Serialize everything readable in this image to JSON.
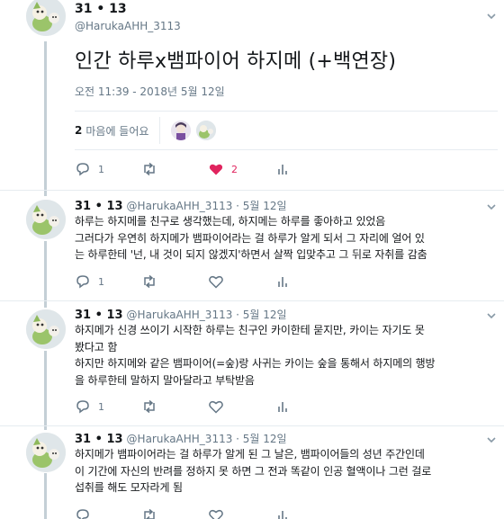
{
  "main_tweet": {
    "author_name": "31 • 13",
    "author_handle": "@HarukaAHH_3113",
    "text": "인간 하루x뱀파이어 하지메 (+백연장)",
    "timestamp": "오전 11:39 - 2018년 5월 12일",
    "likes_count": "2",
    "likes_label": "마음에 들어요",
    "actions": {
      "reply_count": "1",
      "retweet_count": "",
      "like_count": "2"
    }
  },
  "replies": [
    {
      "author_name": "31 • 13",
      "meta": "@HarukaAHH_3113 · 5월 12일",
      "lines": [
        "하루는 하지메를 친구로 생각했는데, 하지메는 하루를 좋아하고 있었음",
        "그러다가 우연히 하지메가 뱀파이어라는 걸 하루가 알게 되서 그 자리에 얼어 있",
        "는 하루한테 '넌, 내 것이 되지 않겠지'하면서 살짝 입맞추고 그 뒤로 자취를 감춤"
      ],
      "reply_count": "1"
    },
    {
      "author_name": "31 • 13",
      "meta": "@HarukaAHH_3113 · 5월 12일",
      "lines": [
        "하지메가 신경 쓰이기 시작한 하루는 친구인 카이한테 묻지만, 카이는 자기도 못",
        "봤다고 함",
        "하지만 하지메와 같은 뱀파이어(=숲)랑 사귀는 카이는 숲을 통해서 하지메의 행방",
        "을 하루한테 말하지 말아달라고 부탁받음"
      ],
      "reply_count": "1"
    },
    {
      "author_name": "31 • 13",
      "meta": "@HarukaAHH_3113 · 5월 12일",
      "lines": [
        "하지메가 뱀파이어라는 걸 하루가 알게 된 그 날은, 뱀파이어들의 성년 주간인데",
        "이 기간에 자신의 반려를 정하지 못 하면 그 전과 똑같이 인공 혈액이나 그런 걸로",
        "섭취를 해도 모자라게 됨"
      ],
      "reply_count": ""
    }
  ],
  "colors": {
    "accent_like": "#e0245e",
    "text_secondary": "#657786",
    "thread_line": "#c4cfd6"
  },
  "icons": [
    "reply-icon",
    "retweet-icon",
    "heart-icon",
    "stats-icon",
    "chevron-down-icon"
  ]
}
